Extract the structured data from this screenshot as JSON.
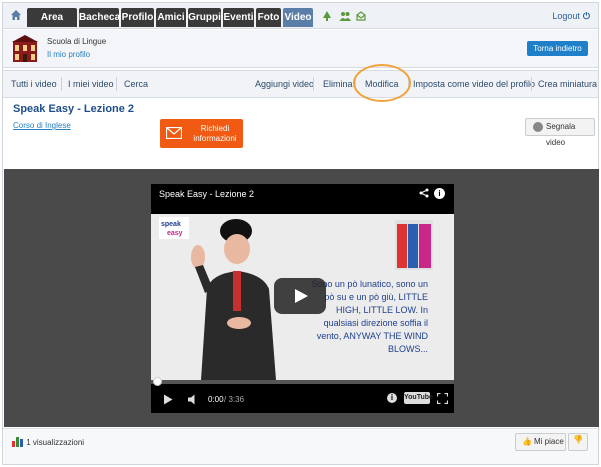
{
  "topnav": {
    "tabs": [
      {
        "label": "Area clienti",
        "active": false
      },
      {
        "label": "Bacheca",
        "active": false
      },
      {
        "label": "Profilo",
        "active": false
      },
      {
        "label": "Amici",
        "active": false
      },
      {
        "label": "Gruppi",
        "active": false
      },
      {
        "label": "Eventi",
        "active": false
      },
      {
        "label": "Foto",
        "active": false
      },
      {
        "label": "Video",
        "active": true
      }
    ],
    "logout_label": "Logout"
  },
  "profile": {
    "name": "Scuola di Lingue",
    "my_profile_link": "Il mio profilo",
    "back_button": "Torna indietro"
  },
  "submenu": {
    "left": [
      "Tutti i video",
      "I miei video",
      "Cerca"
    ],
    "right": [
      "Aggiungi video",
      "Elimina",
      "Modifica",
      "Imposta come video del profilo",
      "Crea miniatura"
    ],
    "highlighted": "Modifica"
  },
  "video": {
    "title": "Speak Easy - Lezione 2",
    "course_link": "Corso di Inglese",
    "request_info_button": "Richiedi informazioni",
    "report_button": "Segnala video"
  },
  "player": {
    "title": "Speak Easy - Lezione 2",
    "lyrics": [
      "Sono un pò lunatico, sono un",
      "pò su e un pò giù, LITTLE",
      "HIGH, LITTLE LOW. In",
      "qualsiasi direzione soffia il",
      "vento, ANYWAY THE WIND",
      "BLOWS..."
    ],
    "time_current": "0:00",
    "time_duration": "/ 3:36",
    "progress_fraction": 0.0,
    "youtube_label": "YouTube",
    "speak_logo": "speak easy"
  },
  "footer": {
    "views": "1 visualizzazioni",
    "like_button": "Mi piace"
  },
  "colors": {
    "active_tab": "#5b7ea8",
    "tab": "#3a3a3a",
    "accent_blue": "#1f7fc9",
    "orange_button": "#f05a12",
    "highlight_circle": "#f3a23a",
    "lyrics_text": "#1e3f8e"
  }
}
